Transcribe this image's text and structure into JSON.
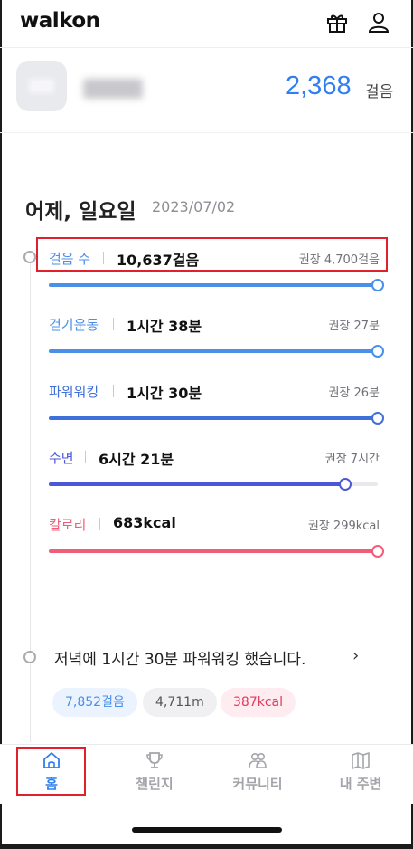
{
  "app": {
    "logo": "walkon"
  },
  "header": {
    "gift_icon": "gift-icon",
    "user_icon": "user-icon"
  },
  "profile": {
    "steps_value": "2,368",
    "steps_unit": "걸음"
  },
  "day": {
    "title": "어제, 일요일",
    "date": "2023/07/02"
  },
  "metrics": [
    {
      "label": "걸음 수",
      "value": "10,637걸음",
      "recommended": "권장 4,700걸음",
      "progress": 1.0,
      "color": "#4a8fe8"
    },
    {
      "label": "걷기운동",
      "value": "1시간 38분",
      "recommended": "권장 27분",
      "progress": 1.0,
      "color": "#4a8fe8"
    },
    {
      "label": "파워워킹",
      "value": "1시간 30분",
      "recommended": "권장 26분",
      "progress": 1.0,
      "color": "#3f6fd9"
    },
    {
      "label": "수면",
      "value": "6시간 21분",
      "recommended": "권장 7시간",
      "progress": 0.9,
      "color": "#4b57d6"
    },
    {
      "label": "칼로리",
      "value": "683kcal",
      "recommended": "권장 299kcal",
      "progress": 1.0,
      "color": "#ef5e78"
    }
  ],
  "summary": {
    "text": "저녁에 1시간 30분 파워워킹 했습니다.",
    "chevron": "›",
    "pills": [
      {
        "text": "7,852걸음",
        "bg": "#ebf3ff",
        "color": "#4a8fe8"
      },
      {
        "text": "4,711m",
        "bg": "#f0f0f2",
        "color": "#555"
      },
      {
        "text": "387kcal",
        "bg": "#ffecf0",
        "color": "#e23b5a"
      }
    ]
  },
  "nav": {
    "items": [
      {
        "label": "홈",
        "icon": "home-icon",
        "active": true
      },
      {
        "label": "챌린지",
        "icon": "trophy-icon",
        "active": false
      },
      {
        "label": "커뮤니티",
        "icon": "community-icon",
        "active": false
      },
      {
        "label": "내 주변",
        "icon": "map-icon",
        "active": false
      }
    ]
  },
  "colors": {
    "accent": "#2f7ff0",
    "highlight_border": "#e0202a"
  }
}
